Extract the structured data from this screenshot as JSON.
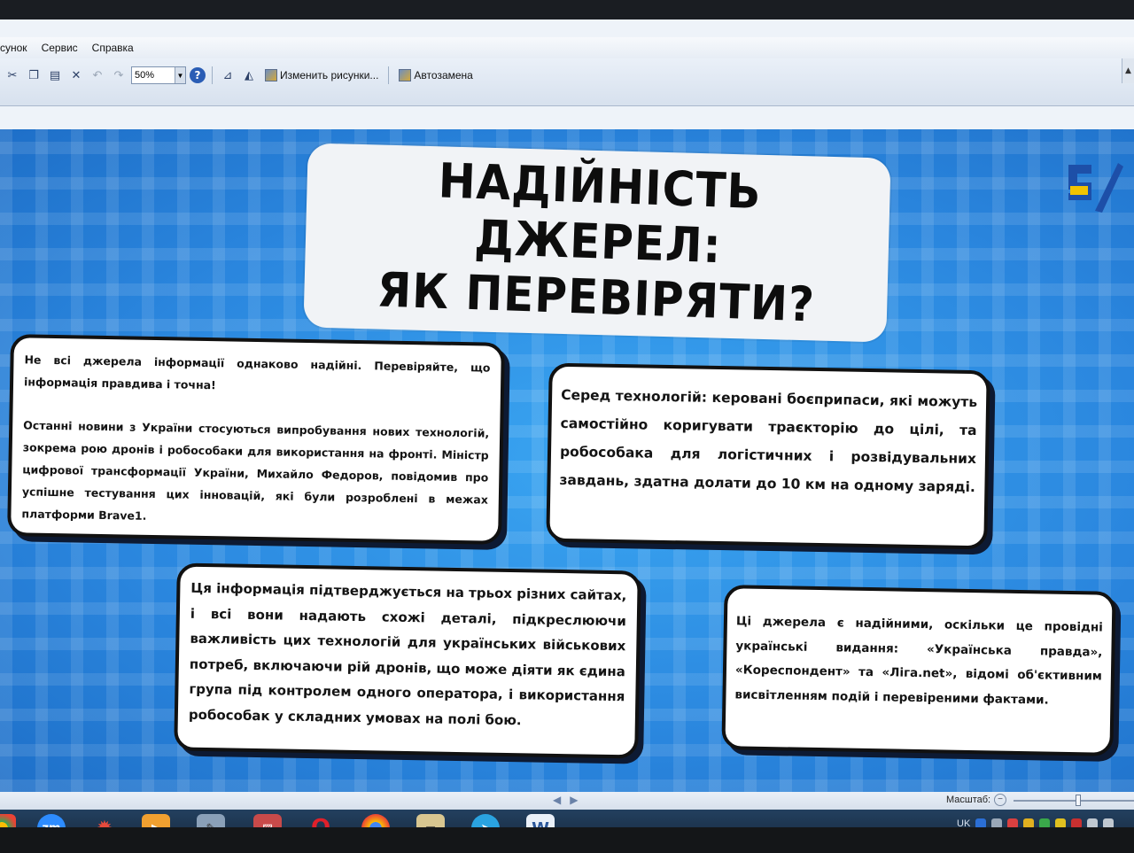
{
  "menu": {
    "items": [
      "сунок",
      "Сервис",
      "Справка"
    ]
  },
  "toolbar": {
    "zoom_value": "50%",
    "change_picture_label": "Изменить рисунки...",
    "autocorrect_label": "Автозамена"
  },
  "slide": {
    "title_line1": "НАДІЙНІСТЬ ДЖЕРЕЛ:",
    "title_line2": "ЯК ПЕРЕВІРЯТИ?",
    "logo_text": "5|",
    "card1_p1": "Не всі джерела інформації однаково надійні. Перевіряйте, що інформація правдива і точна!",
    "card1_p2": "Останні новини з України стосуються випробування нових технологій, зокрема рою дронів і робособаки для використання на фронті. Міністр цифрової трансформації України, Михайло Федоров, повідомив про успішне тестування цих інновацій, які були розроблені в межах платформи Brave1.",
    "card2": "Серед технологій: керовані боєприпаси, які можуть самостійно коригувати траєкторію до цілі, та робособака для логістичних і розвідувальних завдань, здатна долати до 10 км на одному заряді.",
    "card3": "Ця інформація підтверджується на трьох різних сайтах, і всі вони надають схожі деталі, підкреслюючи важливість цих технологій для українських військових потреб, включаючи рій дронів, що може діяти як єдина група під контролем одного оператора, і використання робособак у складних умовах на полі бою.",
    "card4": "Ці джерела є надійними, оскільки це провідні українські видання: «Українська правда», «Кореспондент» та «Ліга.net», відомі об'єктивним висвітленням подій і перевіреними фактами."
  },
  "statusbar": {
    "zoom_label": "Масштаб:"
  },
  "taskbar": {
    "zoom_app_label": "zm",
    "word_app_label": "W",
    "tray_lang": "UK"
  },
  "colors": {
    "slide_blue": "#2f8fe6",
    "logo_yellow": "#f2c300",
    "logo_blue": "#1d4fa8"
  }
}
